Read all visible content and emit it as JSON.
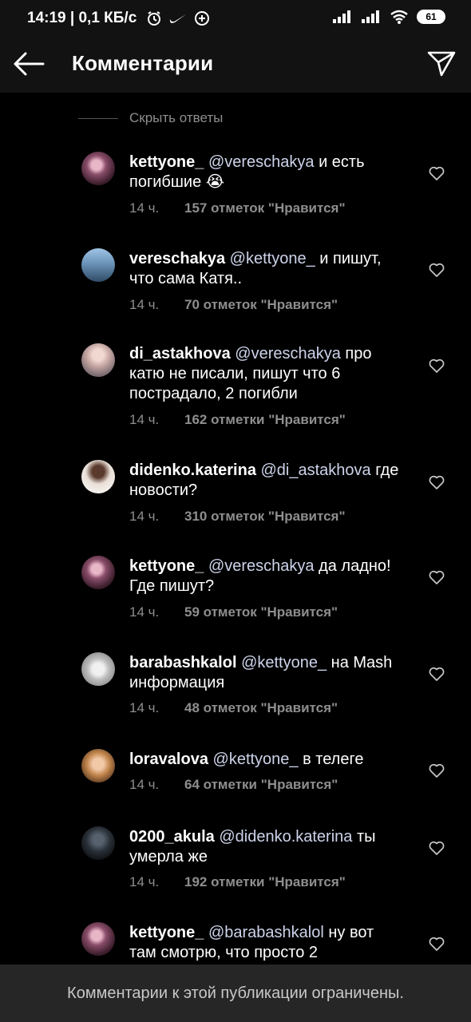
{
  "status_bar": {
    "time_speed": "14:19 | 0,1 КБ/с",
    "battery": "61",
    "icons": [
      "alarm-icon",
      "nike-icon",
      "plus-circle-icon",
      "signal-icon",
      "signal-icon",
      "wifi-icon",
      "battery-icon"
    ]
  },
  "header": {
    "title": "Комментарии",
    "back_icon": "arrow-left-icon",
    "send_icon": "paper-plane-icon"
  },
  "hide_replies": "Скрыть ответы",
  "comments": [
    {
      "user": "kettyone_",
      "mention": "@vereschakya",
      "text": " и есть погибшие 😭",
      "time": "14 ч.",
      "likes": "157 отметок \"Нравится\""
    },
    {
      "user": "vereschakya",
      "mention": "@kettyone_",
      "text": " и пишут, что сама Катя..",
      "time": "14 ч.",
      "likes": "70 отметок \"Нравится\""
    },
    {
      "user": "di_astakhova",
      "mention": "@vereschakya",
      "text": " про катю не писали, пишут что 6 пострадало, 2 погибли",
      "time": "14 ч.",
      "likes": "162 отметки \"Нравится\""
    },
    {
      "user": "didenko.katerina",
      "mention": "@di_astakhova",
      "text": " где новости?",
      "time": "14 ч.",
      "likes": "310 отметок \"Нравится\""
    },
    {
      "user": "kettyone_",
      "mention": "@vereschakya",
      "text": " да ладно! Где пишут?",
      "time": "14 ч.",
      "likes": "59 отметок \"Нравится\""
    },
    {
      "user": "barabashkalol",
      "mention": "@kettyone_",
      "text": " на Mash информация",
      "time": "14 ч.",
      "likes": "48 отметок \"Нравится\""
    },
    {
      "user": "loravalova",
      "mention": "@kettyone_",
      "text": " в телеге",
      "time": "14 ч.",
      "likes": "64 отметки \"Нравится\""
    },
    {
      "user": "0200_akula",
      "mention": "@didenko.katerina",
      "text": " ты умерла же",
      "time": "14 ч.",
      "likes": "192 отметки \"Нравится\""
    },
    {
      "user": "kettyone_",
      "mention": "@barabashkalol",
      "text": " ну вот там смотрю, что просто 2",
      "time": "",
      "likes": ""
    }
  ],
  "footer": "Комментарии к этой публикации ограничены.",
  "colors": {
    "background": "#000000",
    "bar": "#121212",
    "footer": "#262626",
    "muted": "#8e8e8e",
    "mention": "#cdd3ea"
  }
}
